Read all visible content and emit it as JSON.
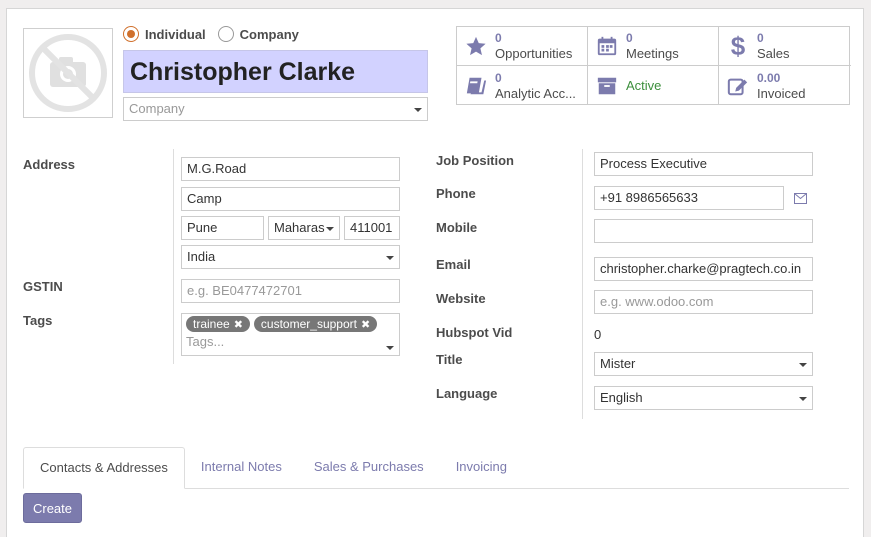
{
  "company_type": {
    "options": [
      {
        "label": "Individual",
        "selected": true
      },
      {
        "label": "Company",
        "selected": false
      }
    ]
  },
  "partner": {
    "name": "Christopher Clarke",
    "company_placeholder": "Company"
  },
  "stats": [
    {
      "value": "0",
      "label": "Opportunities",
      "icon": "star-icon"
    },
    {
      "value": "0",
      "label": "Meetings",
      "icon": "calendar-icon"
    },
    {
      "value": "0",
      "label": "Sales",
      "icon": "dollar-icon"
    },
    {
      "value": "0",
      "label": "Analytic Acc...",
      "icon": "book-icon"
    },
    {
      "value": "",
      "label": "Active",
      "icon": "archive-icon"
    },
    {
      "value": "0.00",
      "label": "Invoiced",
      "icon": "edit-icon"
    }
  ],
  "address": {
    "label": "Address",
    "street": "M.G.Road",
    "street2": "Camp",
    "city": "Pune",
    "state": "Maharas",
    "zip": "411001",
    "country": "India"
  },
  "gstin": {
    "label": "GSTIN",
    "placeholder": "e.g. BE0477472701"
  },
  "tags": {
    "label": "Tags",
    "items": [
      "trainee",
      "customer_support"
    ],
    "placeholder": "Tags..."
  },
  "right_fields": {
    "job_position": {
      "label": "Job Position",
      "value": "Process Executive"
    },
    "phone": {
      "label": "Phone",
      "value": "+91 8986565633"
    },
    "mobile": {
      "label": "Mobile",
      "value": ""
    },
    "email": {
      "label": "Email",
      "value": "christopher.charke@pragtech.co.in"
    },
    "website": {
      "label": "Website",
      "placeholder": "e.g. www.odoo.com"
    },
    "hubspot": {
      "label": "Hubspot Vid",
      "value": "0"
    },
    "title": {
      "label": "Title",
      "value": "Mister"
    },
    "language": {
      "label": "Language",
      "value": "English"
    }
  },
  "tabs": [
    "Contacts & Addresses",
    "Internal Notes",
    "Sales & Purchases",
    "Invoicing"
  ],
  "create_label": "Create",
  "colors": {
    "accent": "#7c7bad",
    "name_bg": "#d2d2ff",
    "radio": "#d0702c"
  }
}
